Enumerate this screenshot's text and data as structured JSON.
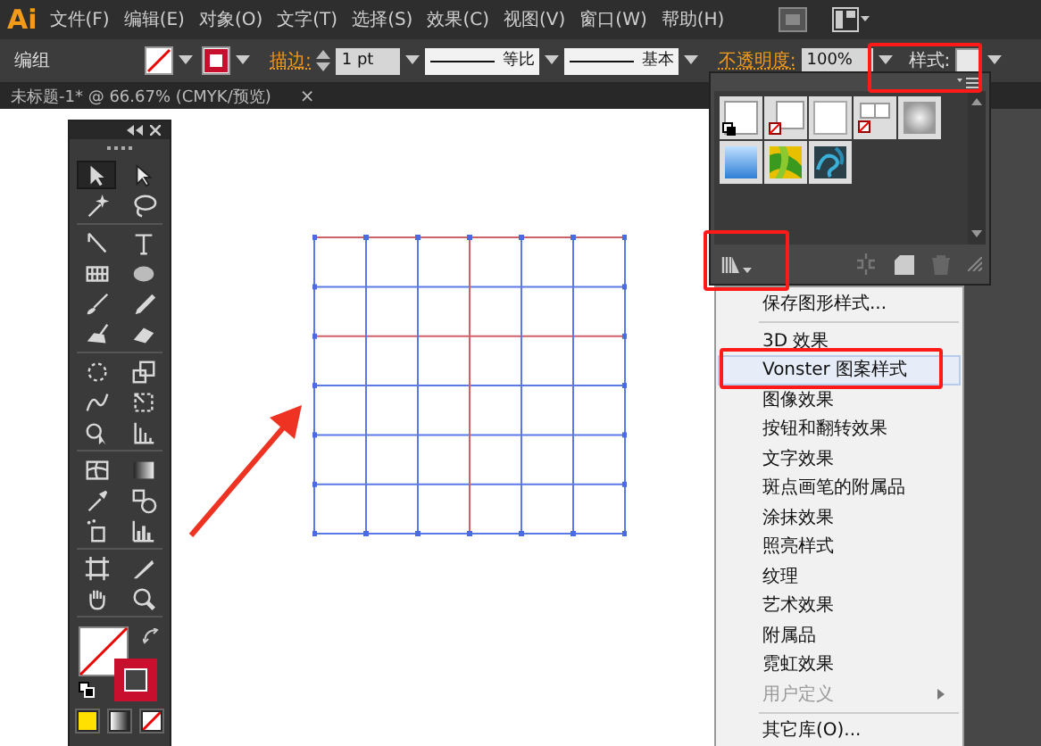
{
  "app": {
    "logo": "Ai"
  },
  "menu_bar": [
    "文件(F)",
    "编辑(E)",
    "对象(O)",
    "文字(T)",
    "选择(S)",
    "效果(C)",
    "视图(V)",
    "窗口(W)",
    "帮助(H)"
  ],
  "control_bar": {
    "selection": "编组",
    "stroke_label": "描边:",
    "stroke_weight": "1 pt",
    "profile": "等比",
    "brush": "基本",
    "opacity_label": "不透明度:",
    "opacity": "100%",
    "style_label": "样式:"
  },
  "document_tab": {
    "title": "未标题-1* @ 66.67% (CMYK/预览)",
    "close": "×"
  },
  "tools": [
    {
      "selected": true
    },
    {
      "selected": false
    },
    {
      "selected": false
    },
    {
      "selected": false
    },
    {
      "selected": false
    },
    {
      "selected": false
    },
    {
      "selected": false
    },
    {
      "selected": false
    },
    {
      "selected": false
    },
    {
      "selected": false
    },
    {
      "selected": false
    },
    {
      "selected": false
    },
    {
      "selected": false
    },
    {
      "selected": false
    },
    {
      "selected": false
    },
    {
      "selected": false
    },
    {
      "selected": false
    },
    {
      "selected": false
    },
    {
      "selected": false
    },
    {
      "selected": false
    },
    {
      "selected": false
    },
    {
      "selected": false
    },
    {
      "selected": false
    },
    {
      "selected": false
    },
    {
      "selected": false
    },
    {
      "selected": false
    },
    {
      "selected": false
    },
    {
      "selected": false
    }
  ],
  "graphic_styles_menu": {
    "items": [
      {
        "kind": "item",
        "label": "保存图形样式...",
        "selected": false,
        "disabled": false,
        "submenu": false
      },
      {
        "kind": "separator"
      },
      {
        "kind": "item",
        "label": "3D 效果",
        "selected": false,
        "disabled": false,
        "submenu": false
      },
      {
        "kind": "item",
        "label": "Vonster 图案样式",
        "selected": true,
        "disabled": false,
        "submenu": false
      },
      {
        "kind": "item",
        "label": "图像效果",
        "selected": false,
        "disabled": false,
        "submenu": false
      },
      {
        "kind": "item",
        "label": "按钮和翻转效果",
        "selected": false,
        "disabled": false,
        "submenu": false
      },
      {
        "kind": "item",
        "label": "文字效果",
        "selected": false,
        "disabled": false,
        "submenu": false
      },
      {
        "kind": "item",
        "label": "斑点画笔的附属品",
        "selected": false,
        "disabled": false,
        "submenu": false
      },
      {
        "kind": "item",
        "label": "涂抹效果",
        "selected": false,
        "disabled": false,
        "submenu": false
      },
      {
        "kind": "item",
        "label": "照亮样式",
        "selected": false,
        "disabled": false,
        "submenu": false
      },
      {
        "kind": "item",
        "label": "纹理",
        "selected": false,
        "disabled": false,
        "submenu": false
      },
      {
        "kind": "item",
        "label": "艺术效果",
        "selected": false,
        "disabled": false,
        "submenu": false
      },
      {
        "kind": "item",
        "label": "附属品",
        "selected": false,
        "disabled": false,
        "submenu": false
      },
      {
        "kind": "item",
        "label": "霓虹效果",
        "selected": false,
        "disabled": false,
        "submenu": false
      },
      {
        "kind": "item",
        "label": "用户定义",
        "selected": false,
        "disabled": true,
        "submenu": true
      },
      {
        "kind": "separator"
      },
      {
        "kind": "item",
        "label": "其它库(O)...",
        "selected": false,
        "disabled": false,
        "submenu": false
      }
    ]
  }
}
